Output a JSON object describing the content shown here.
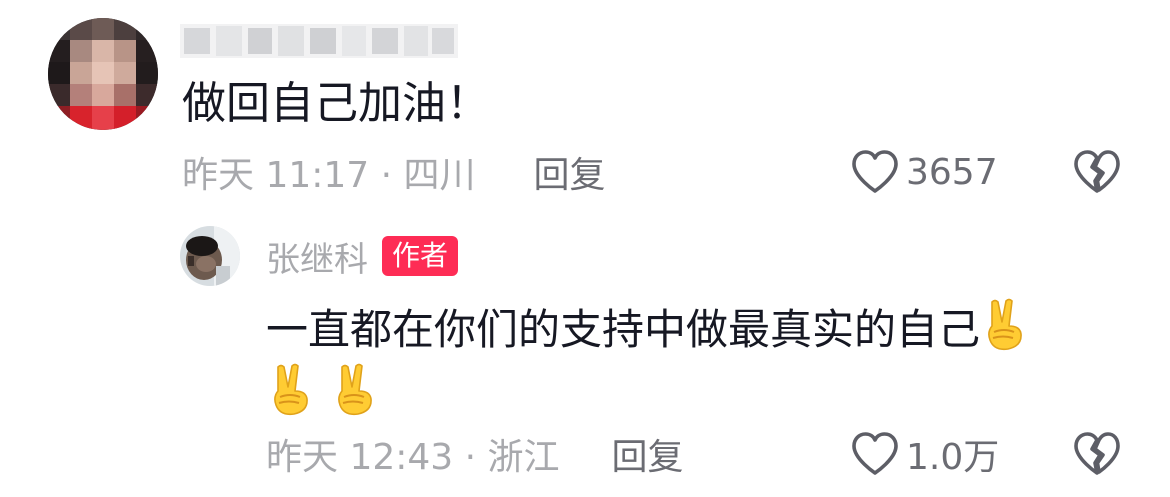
{
  "comment": {
    "username_display": "",
    "text": "做回自己加油！",
    "time_location": "昨天 11:17 · 四川",
    "reply_label": "回复",
    "like_count": "3657"
  },
  "reply": {
    "username": "张继科",
    "author_badge": "作者",
    "text": "一直都在你们的支持中做最真实的自己",
    "emojis": [
      "victory-hand",
      "victory-hand",
      "victory-hand"
    ],
    "time_location": "昨天 12:43 · 浙江",
    "reply_label": "回复",
    "like_count": "1.0万"
  },
  "colors": {
    "primary_text": "#161823",
    "secondary_text": "#a8a9ad",
    "action_text": "#6b6c73",
    "badge": "#fe2c55"
  },
  "icons": {
    "like": "heart-outline-icon",
    "dislike": "broken-heart-icon",
    "emoji": "victory-hand-emoji"
  }
}
